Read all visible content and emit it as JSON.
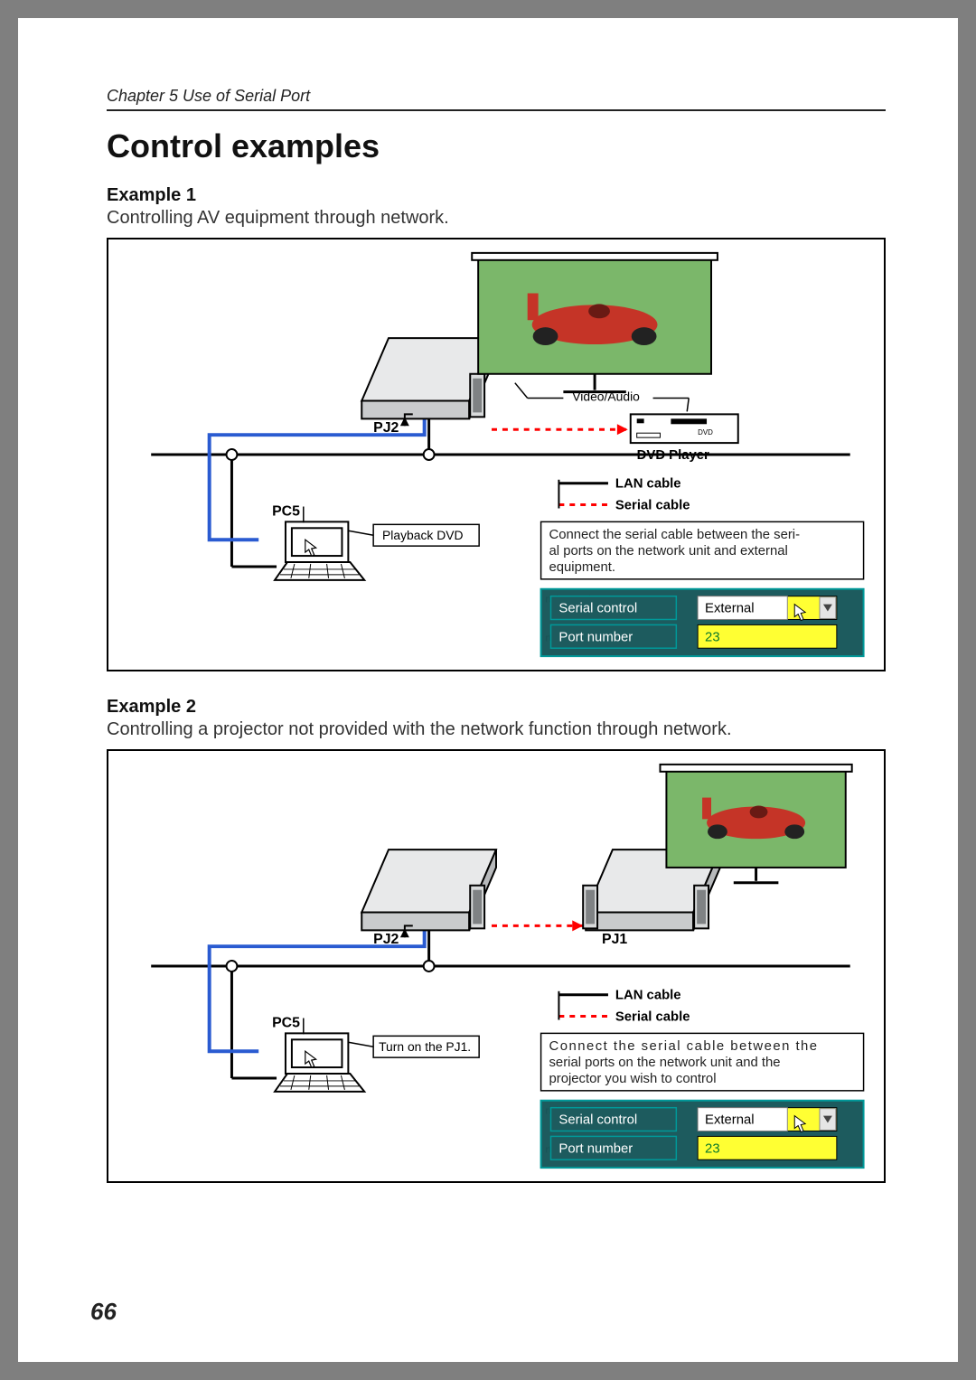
{
  "chapter": "Chapter 5 Use of Serial Port",
  "heading": "Control examples",
  "page_number": "66",
  "example1": {
    "title": "Example 1",
    "desc": "Controlling AV equipment through network.",
    "pj2": "PJ2",
    "pc5": "PC5",
    "playback": "Playback DVD",
    "video_audio": "Video/Audio",
    "dvd_player": "DVD Player",
    "lan_cable": "LAN cable",
    "serial_cable": "Serial cable",
    "note": "Connect the serial cable between the serial ports on the network unit and external equipment.",
    "note_l1": "Connect the serial cable between the seri-",
    "note_l2": "al ports on the network unit and external",
    "note_l3": "equipment.",
    "ui_serial_control": "Serial control",
    "ui_port_number": "Port number",
    "ui_external": "External",
    "ui_port_value": "23"
  },
  "example2": {
    "title": "Example 2",
    "desc": "Controlling a projector not provided with the network function through network.",
    "pj2": "PJ2",
    "pj1": "PJ1",
    "pc5": "PC5",
    "turn_on": "Turn on the PJ1.",
    "lan_cable": "LAN cable",
    "serial_cable": "Serial cable",
    "note_l1": "Connect the serial cable between the",
    "note_l2": "serial ports on the network unit and the",
    "note_l3": "projector you wish to control",
    "ui_serial_control": "Serial control",
    "ui_port_number": "Port number",
    "ui_external": "External",
    "ui_port_value": "23"
  }
}
